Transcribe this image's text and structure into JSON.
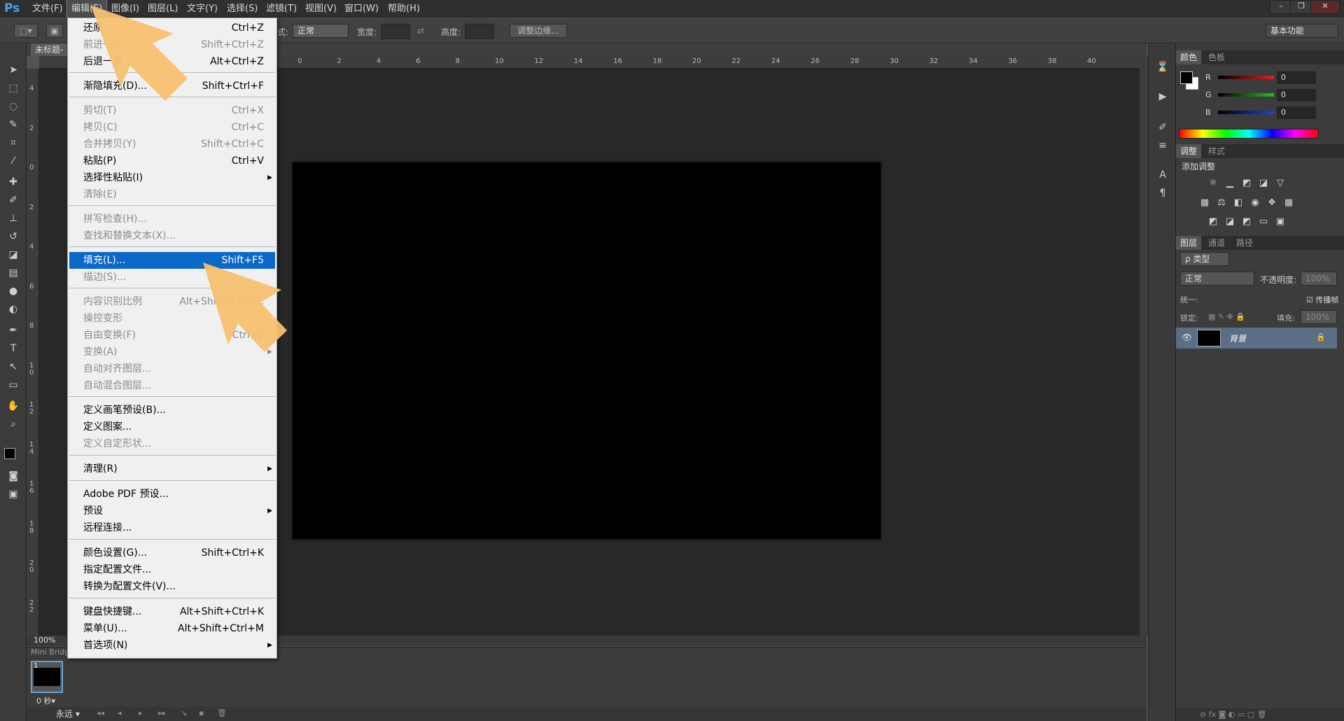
{
  "app": {
    "logo": "Ps"
  },
  "menubar": {
    "items": [
      "文件(F)",
      "编辑(E)",
      "图像(I)",
      "图层(L)",
      "文字(Y)",
      "选择(S)",
      "滤镜(T)",
      "视图(V)",
      "窗口(W)",
      "帮助(H)"
    ],
    "active_index": 1
  },
  "window_controls": {
    "minimize": "–",
    "restore": "❐",
    "close": "✕"
  },
  "options_bar": {
    "style_label": "式:",
    "style_value": "正常",
    "width_label": "宽度:",
    "height_label": "高度:",
    "refine_edge": "调整边缘...",
    "workspace": "基本功能"
  },
  "document": {
    "tab_title": "未标题-",
    "zoom": "100%",
    "ruler_top_ticks": [
      "0",
      "2",
      "4",
      "6",
      "8",
      "10",
      "12",
      "14",
      "16",
      "18",
      "20",
      "22",
      "24",
      "26",
      "28",
      "30",
      "32",
      "34",
      "36",
      "38",
      "40"
    ],
    "ruler_left_ticks": [
      "4",
      "2",
      "0",
      "2",
      "4",
      "6",
      "8",
      "1 0",
      "1 2",
      "1 4",
      "1 6",
      "1 8",
      "2 0",
      "2 2"
    ]
  },
  "mini_bridge": {
    "title": "Mini Bridge",
    "frame_number": "1",
    "frame_time": "0 秒▾",
    "loop": "永远"
  },
  "color_panel": {
    "tabs": [
      "颜色",
      "色板"
    ],
    "channels": [
      {
        "name": "R",
        "value": "0",
        "color": "#e02020"
      },
      {
        "name": "G",
        "value": "0",
        "color": "#20c020"
      },
      {
        "name": "B",
        "value": "0",
        "color": "#2040e0"
      }
    ]
  },
  "adjust_panel": {
    "tabs": [
      "调整",
      "样式"
    ],
    "title": "添加调整",
    "icons_row1": [
      "brightness-icon",
      "levels-icon",
      "curves-icon",
      "exposure-icon",
      "vibrance-icon"
    ],
    "icons_row2": [
      "hue-icon",
      "balance-icon",
      "bw-icon",
      "photo-filter-icon",
      "mixer-icon",
      "lookup-icon"
    ],
    "icons_row3": [
      "invert-icon",
      "posterize-icon",
      "threshold-icon",
      "gradient-map-icon",
      "selective-color-icon"
    ]
  },
  "layers_panel": {
    "tabs": [
      "图层",
      "通道",
      "路径"
    ],
    "filter_kind": "ρ 类型",
    "blend_mode": "正常",
    "opacity_label": "不透明度:",
    "opacity_value": "100%",
    "unify_label": "统一:",
    "propagate_label": "传播帧",
    "lock_label": "锁定:",
    "fill_label": "填充:",
    "fill_value": "100%",
    "layer_name": "背景"
  },
  "edit_menu": {
    "items": [
      {
        "label": "还原",
        "shortcut": "Ctrl+Z",
        "disabled": false
      },
      {
        "label": "前进一步",
        "shortcut": "Shift+Ctrl+Z",
        "disabled": true
      },
      {
        "label": "后退一步",
        "shortcut": "Alt+Ctrl+Z",
        "disabled": false
      },
      {
        "label": "渐隐填充(D)...",
        "shortcut": "Shift+Ctrl+F",
        "disabled": false
      },
      {
        "label": "剪切(T)",
        "shortcut": "Ctrl+X",
        "disabled": true
      },
      {
        "label": "拷贝(C)",
        "shortcut": "Ctrl+C",
        "disabled": true
      },
      {
        "label": "合并拷贝(Y)",
        "shortcut": "Shift+Ctrl+C",
        "disabled": true
      },
      {
        "label": "粘贴(P)",
        "shortcut": "Ctrl+V",
        "disabled": false
      },
      {
        "label": "选择性粘贴(I)",
        "shortcut": "",
        "disabled": false,
        "submenu": true
      },
      {
        "label": "清除(E)",
        "shortcut": "",
        "disabled": true
      },
      {
        "label": "拼写检查(H)...",
        "shortcut": "",
        "disabled": true
      },
      {
        "label": "查找和替换文本(X)...",
        "shortcut": "",
        "disabled": true
      },
      {
        "label": "填充(L)...",
        "shortcut": "Shift+F5",
        "disabled": false,
        "highlighted": true
      },
      {
        "label": "描边(S)...",
        "shortcut": "",
        "disabled": true
      },
      {
        "label": "内容识别比例",
        "shortcut": "Alt+Shift+Ctrl+C",
        "disabled": true
      },
      {
        "label": "操控变形",
        "shortcut": "",
        "disabled": true
      },
      {
        "label": "自由变换(F)",
        "shortcut": "Ctrl+T",
        "disabled": true
      },
      {
        "label": "变换(A)",
        "shortcut": "",
        "disabled": true,
        "submenu": true
      },
      {
        "label": "自动对齐图层...",
        "shortcut": "",
        "disabled": true
      },
      {
        "label": "自动混合图层...",
        "shortcut": "",
        "disabled": true
      },
      {
        "label": "定义画笔预设(B)...",
        "shortcut": "",
        "disabled": false
      },
      {
        "label": "定义图案...",
        "shortcut": "",
        "disabled": false
      },
      {
        "label": "定义自定形状...",
        "shortcut": "",
        "disabled": true
      },
      {
        "label": "清理(R)",
        "shortcut": "",
        "disabled": false,
        "submenu": true
      },
      {
        "label": "Adobe PDF 预设...",
        "shortcut": "",
        "disabled": false
      },
      {
        "label": "预设",
        "shortcut": "",
        "disabled": false,
        "submenu": true
      },
      {
        "label": "远程连接...",
        "shortcut": "",
        "disabled": false
      },
      {
        "label": "颜色设置(G)...",
        "shortcut": "Shift+Ctrl+K",
        "disabled": false
      },
      {
        "label": "指定配置文件...",
        "shortcut": "",
        "disabled": false
      },
      {
        "label": "转换为配置文件(V)...",
        "shortcut": "",
        "disabled": false
      },
      {
        "label": "键盘快捷键...",
        "shortcut": "Alt+Shift+Ctrl+K",
        "disabled": false
      },
      {
        "label": "菜单(U)...",
        "shortcut": "Alt+Shift+Ctrl+M",
        "disabled": false
      },
      {
        "label": "首选项(N)",
        "shortcut": "",
        "disabled": false,
        "submenu": true
      }
    ]
  },
  "accent_colors": {
    "highlight": "#0a69c7",
    "annotation_arrow": "#f5c070"
  }
}
